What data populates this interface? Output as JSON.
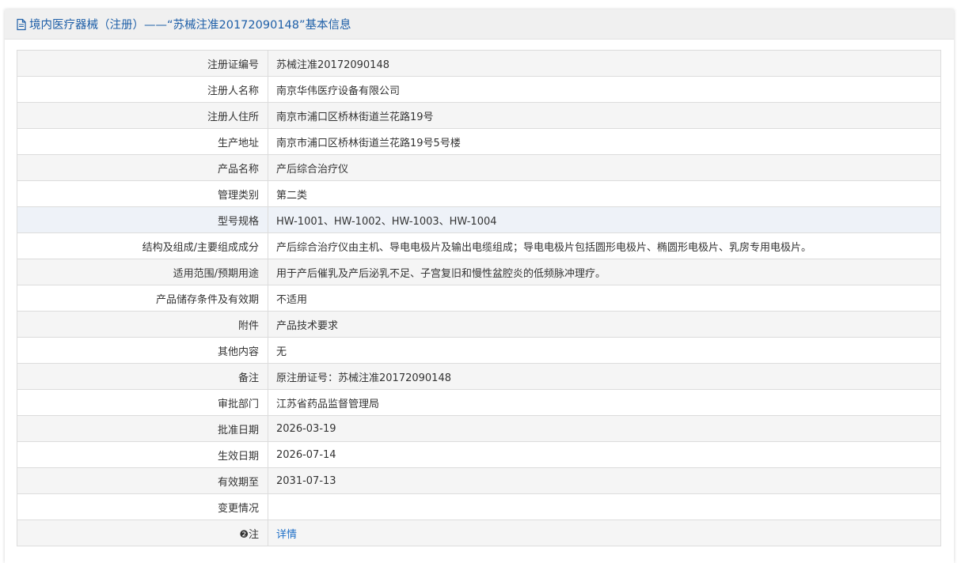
{
  "header": {
    "title": "境内医疗器械（注册）——“苏械注准20172090148”基本信息"
  },
  "rows": [
    {
      "label": "注册证编号",
      "value": "苏械注准20172090148"
    },
    {
      "label": "注册人名称",
      "value": "南京华伟医疗设备有限公司"
    },
    {
      "label": "注册人住所",
      "value": "南京市浦口区桥林街道兰花路19号"
    },
    {
      "label": "生产地址",
      "value": "南京市浦口区桥林街道兰花路19号5号楼"
    },
    {
      "label": "产品名称",
      "value": "产后综合治疗仪"
    },
    {
      "label": "管理类别",
      "value": "第二类"
    },
    {
      "label": "型号规格",
      "value": "HW-1001、HW-1002、HW-1003、HW-1004"
    },
    {
      "label": "结构及组成/主要组成成分",
      "value": "产后综合治疗仪由主机、导电电极片及输出电缆组成；导电电极片包括圆形电极片、椭圆形电极片、乳房专用电极片。"
    },
    {
      "label": "适用范围/预期用途",
      "value": "用于产后催乳及产后泌乳不足、子宫复旧和慢性盆腔炎的低频脉冲理疗。"
    },
    {
      "label": "产品储存条件及有效期",
      "value": "不适用"
    },
    {
      "label": "附件",
      "value": "产品技术要求"
    },
    {
      "label": "其他内容",
      "value": "无"
    },
    {
      "label": "备注",
      "value": "原注册证号：苏械注准20172090148"
    },
    {
      "label": "审批部门",
      "value": "江苏省药品监督管理局"
    },
    {
      "label": "批准日期",
      "value": "2026-03-19"
    },
    {
      "label": "生效日期",
      "value": "2026-07-14"
    },
    {
      "label": "有效期至",
      "value": "2031-07-13"
    },
    {
      "label": "变更情况",
      "value": ""
    },
    {
      "label": "❷注",
      "value": "详情"
    }
  ],
  "colors": {
    "title": "#1e5fa8",
    "link": "#1e6fc7",
    "row_alt": "#f5f5f5",
    "row_highlight": "#eef2f8"
  }
}
